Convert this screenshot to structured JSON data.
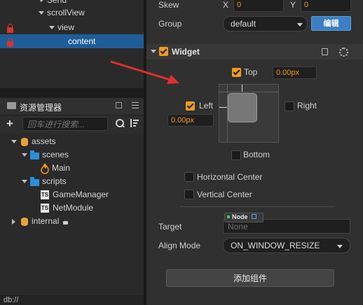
{
  "hierarchy": {
    "items": [
      {
        "label": "Send"
      },
      {
        "label": "scrollView"
      },
      {
        "label": "view"
      },
      {
        "label": "content"
      }
    ]
  },
  "assets": {
    "title": "资源管理器",
    "search_placeholder": "回车进行搜索...",
    "tree": [
      {
        "label": "assets"
      },
      {
        "label": "scenes"
      },
      {
        "label": "Main"
      },
      {
        "label": "scripts"
      },
      {
        "label": "GameManager"
      },
      {
        "label": "NetModule"
      },
      {
        "label": "internal"
      }
    ],
    "ts_badge": "TS"
  },
  "inspector": {
    "skew_label": "Skew",
    "skew_x_label": "X",
    "skew_x_value": "0",
    "skew_y_label": "Y",
    "skew_y_value": "0",
    "group_label": "Group",
    "group_value": "default",
    "group_edit_button": "编辑",
    "widget": {
      "title": "Widget",
      "top_label": "Top",
      "top_value": "0.00px",
      "left_label": "Left",
      "left_value": "0.00px",
      "right_label": "Right",
      "bottom_label": "Bottom",
      "horizontal_center_label": "Horizontal Center",
      "vertical_center_label": "Vertical Center",
      "target_label": "Target",
      "node_chip": "Node",
      "target_value": "None",
      "align_mode_label": "Align Mode",
      "align_mode_value": "ON_WINDOW_RESIZE"
    },
    "add_component_button": "添加组件"
  },
  "status_bar": {
    "text": "db://"
  },
  "colors": {
    "accent_orange": "#f39b1c",
    "selection_blue": "#1f5d99",
    "button_blue": "#3b7fc4",
    "annotation_arrow": "#e0302b"
  }
}
